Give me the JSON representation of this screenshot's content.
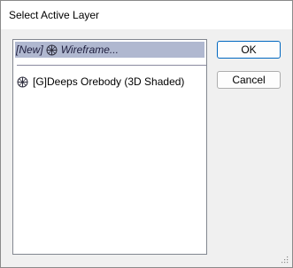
{
  "dialog": {
    "title": "Select Active Layer"
  },
  "layer_list": {
    "items": [
      {
        "label": "[New]",
        "name": "Wireframe...",
        "icon": "wireframe-icon",
        "selected": true
      },
      {
        "label": "[G]Deeps Orebody (3D Shaded)",
        "icon": "wireframe-icon",
        "selected": false
      }
    ]
  },
  "buttons": {
    "ok_label": "OK",
    "cancel_label": "Cancel"
  },
  "colors": {
    "selection": "#b0b8d0",
    "default_button_border": "#0067c0"
  }
}
